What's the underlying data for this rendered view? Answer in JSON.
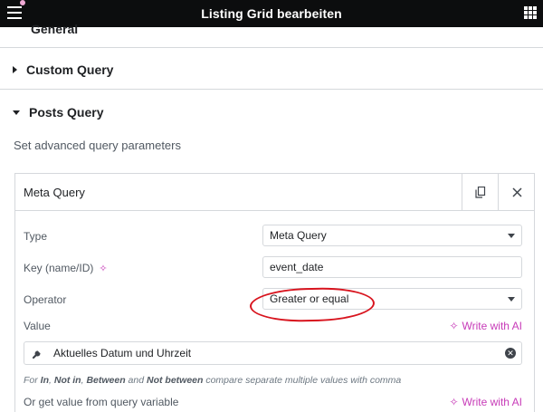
{
  "header": {
    "title": "Listing Grid bearbeiten",
    "left_icon": "hamburger-menu-icon",
    "right_icon": "apps-grid-icon"
  },
  "sections": {
    "general_peek": "General",
    "custom_query": "Custom Query",
    "posts_query": "Posts Query",
    "posts_query_description": "Set advanced query parameters"
  },
  "meta_panel": {
    "title": "Meta Query",
    "copy_icon": "duplicate-icon",
    "close_icon": "close-icon",
    "type_label": "Type",
    "type_value": "Meta Query",
    "key_label": "Key (name/ID)",
    "key_value": "event_date",
    "operator_label": "Operator",
    "operator_value": "Greater or equal",
    "value_label": "Value",
    "write_ai": "Write with AI",
    "dynamic_value": "Aktuelles Datum und Uhrzeit",
    "hint": {
      "p1": "For ",
      "in": "In",
      "p2": ", ",
      "not_in": "Not in",
      "p3": ", ",
      "between": "Between",
      "p4": " and ",
      "not_between": "Not between",
      "p5": " compare separate multiple values with comma"
    },
    "query_var_label": "Or get value from query variable",
    "write_ai_2": "Write with AI"
  },
  "colors": {
    "topbar": "#0c0d0e",
    "ai_accent": "#c73bb8",
    "annotation": "#d8141e"
  }
}
